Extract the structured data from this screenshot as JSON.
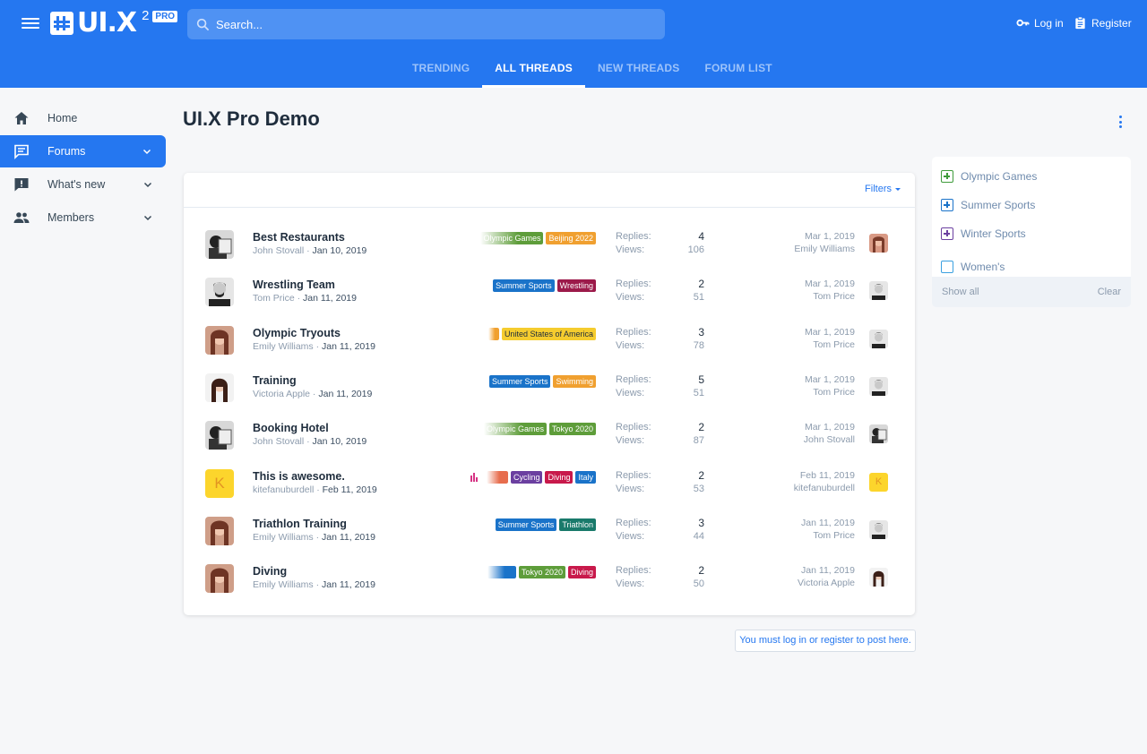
{
  "header": {
    "logo_text": "UI.X",
    "logo_version": "2",
    "logo_badge": "PRO",
    "search_placeholder": "Search...",
    "login_label": "Log in",
    "register_label": "Register"
  },
  "tabs": [
    {
      "label": "TRENDING",
      "active": false
    },
    {
      "label": "ALL THREADS",
      "active": true
    },
    {
      "label": "NEW THREADS",
      "active": false
    },
    {
      "label": "FORUM LIST",
      "active": false
    }
  ],
  "sidebar": {
    "items": [
      {
        "label": "Home",
        "icon": "home-icon",
        "active": false
      },
      {
        "label": "Forums",
        "icon": "forum-icon",
        "active": true
      },
      {
        "label": "What's new",
        "icon": "whats-new-icon",
        "active": false
      },
      {
        "label": "Members",
        "icon": "members-icon",
        "active": false
      }
    ]
  },
  "page": {
    "title": "UI.X Pro Demo",
    "filters_label": "Filters",
    "notice": "You must log in or register to post here."
  },
  "labels": {
    "replies": "Replies:",
    "views": "Views:"
  },
  "threads": [
    {
      "title": "Best Restaurants",
      "author": "John Stovall",
      "date": "Jan 10, 2019",
      "tags": [
        "Olympic Games",
        "Beijing 2022"
      ],
      "replies": "4",
      "views": "106",
      "last_date": "Mar 1, 2019",
      "last_user": "Emily Williams"
    },
    {
      "title": "Wrestling Team",
      "author": "Tom Price",
      "date": "Jan 11, 2019",
      "tags": [
        "Summer Sports",
        "Wrestling"
      ],
      "replies": "2",
      "views": "51",
      "last_date": "Mar 1, 2019",
      "last_user": "Tom Price"
    },
    {
      "title": "Olympic Tryouts",
      "author": "Emily Williams",
      "date": "Jan 11, 2019",
      "tags": [
        "United States of America"
      ],
      "replies": "3",
      "views": "78",
      "last_date": "Mar 1, 2019",
      "last_user": "Tom Price"
    },
    {
      "title": "Training",
      "author": "Victoria Apple",
      "date": "Jan 11, 2019",
      "tags": [
        "Summer Sports",
        "Swimming"
      ],
      "replies": "5",
      "views": "51",
      "last_date": "Mar 1, 2019",
      "last_user": "Tom Price"
    },
    {
      "title": "Booking Hotel",
      "author": "John Stovall",
      "date": "Jan 10, 2019",
      "tags": [
        "Olympic Games",
        "Tokyo 2020"
      ],
      "replies": "2",
      "views": "87",
      "last_date": "Mar 1, 2019",
      "last_user": "John Stovall"
    },
    {
      "title": "This is awesome.",
      "author": "kitefanuburdell",
      "date": "Feb 11, 2019",
      "tags": [
        "Cycling",
        "Diving",
        "Italy"
      ],
      "replies": "2",
      "views": "53",
      "last_date": "Feb 11, 2019",
      "last_user": "kitefanuburdell"
    },
    {
      "title": "Triathlon Training",
      "author": "Emily Williams",
      "date": "Jan 11, 2019",
      "tags": [
        "Summer Sports",
        "Triathlon"
      ],
      "replies": "3",
      "views": "44",
      "last_date": "Jan 11, 2019",
      "last_user": "Tom Price"
    },
    {
      "title": "Diving",
      "author": "Emily Williams",
      "date": "Jan 11, 2019",
      "tags": [
        "Tokyo 2020",
        "Diving"
      ],
      "replies": "2",
      "views": "50",
      "last_date": "Jan 11, 2019",
      "last_user": "Victoria Apple"
    }
  ],
  "filter_panel": {
    "options": [
      {
        "label": "Olympic Games",
        "color": "#3e9b3a"
      },
      {
        "label": "Summer Sports",
        "color": "#1a73c9"
      },
      {
        "label": "Winter Sports",
        "color": "#6b3fa0"
      },
      {
        "label": "Women's",
        "color": "#3aa0e0"
      }
    ],
    "show_all": "Show all",
    "clear": "Clear"
  },
  "colors": {
    "accent": "#2577f0"
  }
}
